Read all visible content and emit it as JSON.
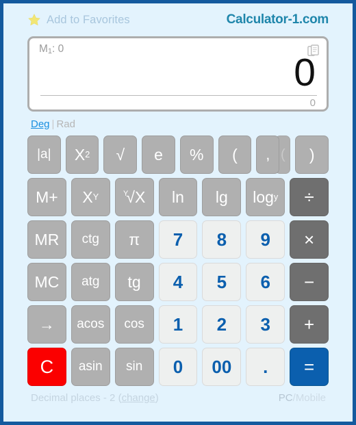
{
  "header": {
    "favorites_label": "Add to Favorites",
    "star_icon": "star-icon",
    "logo": "Calculator-1.com"
  },
  "display": {
    "memory_prefix": "M",
    "memory_index": "1",
    "memory_separator": ": ",
    "memory_value": "0",
    "copy_icon": "copy-icon",
    "main_value": "0",
    "sub_value": "0"
  },
  "angle_mode": {
    "deg_label": "Deg",
    "separator": "|",
    "rad_label": "Rad",
    "active": "Deg"
  },
  "keypad": {
    "rows": [
      [
        {
          "label": "|a|",
          "type": "fn",
          "name": "abs"
        },
        {
          "label": "X",
          "sup": "2",
          "type": "fn",
          "name": "square"
        },
        {
          "label": "√",
          "type": "fn",
          "name": "sqrt"
        },
        {
          "label": "e",
          "type": "fn",
          "name": "euler"
        },
        {
          "label": "%",
          "type": "fn",
          "name": "percent"
        },
        {
          "label": "(",
          "type": "fn",
          "name": "open-paren"
        },
        {
          "label": ",",
          "type": "fn",
          "name": "comma"
        },
        {
          "label": "(",
          "type": "fn",
          "name": "hidden-paren"
        },
        {
          "label": ")",
          "type": "fn",
          "name": "close-paren"
        }
      ],
      [
        {
          "label": "M+",
          "type": "fn",
          "name": "memory-add"
        },
        {
          "label": "X",
          "sup": "Y",
          "type": "fn",
          "name": "power"
        },
        {
          "label": "√X",
          "idx": "Y",
          "type": "fn",
          "name": "nth-root"
        },
        {
          "label": "ln",
          "type": "fn",
          "name": "natural-log"
        },
        {
          "label": "lg",
          "type": "fn",
          "name": "log10"
        },
        {
          "label": "log",
          "sub": "y",
          "type": "fn",
          "name": "log-base-y"
        },
        {
          "label": "÷",
          "type": "op",
          "name": "divide"
        }
      ],
      [
        {
          "label": "MR",
          "type": "fn",
          "name": "memory-recall"
        },
        {
          "label": "ctg",
          "type": "fn",
          "name": "cotangent"
        },
        {
          "label": "π",
          "type": "fn",
          "name": "pi"
        },
        {
          "label": "7",
          "type": "num",
          "name": "digit-7"
        },
        {
          "label": "8",
          "type": "num",
          "name": "digit-8"
        },
        {
          "label": "9",
          "type": "num",
          "name": "digit-9"
        },
        {
          "label": "×",
          "type": "op",
          "name": "multiply"
        }
      ],
      [
        {
          "label": "MC",
          "type": "fn",
          "name": "memory-clear"
        },
        {
          "label": "atg",
          "type": "fn",
          "name": "arctangent"
        },
        {
          "label": "tg",
          "type": "fn",
          "name": "tangent"
        },
        {
          "label": "4",
          "type": "num",
          "name": "digit-4"
        },
        {
          "label": "5",
          "type": "num",
          "name": "digit-5"
        },
        {
          "label": "6",
          "type": "num",
          "name": "digit-6"
        },
        {
          "label": "−",
          "type": "op",
          "name": "subtract"
        }
      ],
      [
        {
          "label": "→",
          "type": "fn",
          "name": "backspace"
        },
        {
          "label": "acos",
          "type": "fn",
          "name": "arccosine"
        },
        {
          "label": "cos",
          "type": "fn",
          "name": "cosine"
        },
        {
          "label": "1",
          "type": "num",
          "name": "digit-1"
        },
        {
          "label": "2",
          "type": "num",
          "name": "digit-2"
        },
        {
          "label": "3",
          "type": "num",
          "name": "digit-3"
        },
        {
          "label": "+",
          "type": "op",
          "name": "add"
        }
      ],
      [
        {
          "label": "C",
          "type": "clear",
          "name": "clear"
        },
        {
          "label": "asin",
          "type": "fn",
          "name": "arcsine"
        },
        {
          "label": "sin",
          "type": "fn",
          "name": "sine"
        },
        {
          "label": "0",
          "type": "num",
          "name": "digit-0"
        },
        {
          "label": "00",
          "type": "num",
          "name": "digit-double-zero"
        },
        {
          "label": ".",
          "type": "num",
          "name": "decimal-point"
        },
        {
          "label": "=",
          "type": "eq",
          "name": "equals"
        }
      ]
    ]
  },
  "footer": {
    "decimal_places_text": "Decimal places - 2",
    "change_label": "change",
    "paren_open": "(",
    "paren_close": ")",
    "pc_label": "PC",
    "slash": "/",
    "mobile_label": "Mobile"
  },
  "colors": {
    "page_border": "#145a9e",
    "page_background": "#e3f3fd",
    "logo": "#1f86ab",
    "digit": "#0b5fae",
    "equals": "#0b5fae",
    "clear": "#fb0000",
    "operator": "#6f6f6f",
    "function": "#b0b0b0",
    "active_mode": "#1a8fe0"
  }
}
